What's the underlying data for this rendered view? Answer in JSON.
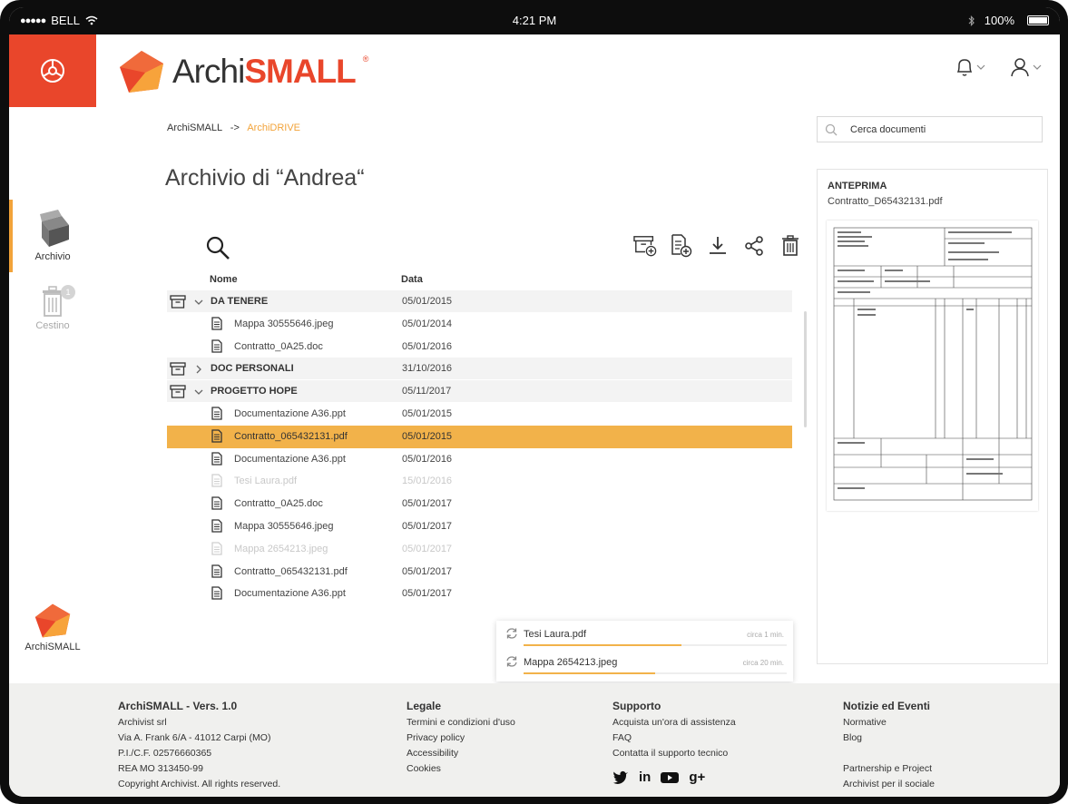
{
  "status_bar": {
    "carrier": "BELL",
    "time": "4:21 PM",
    "battery": "100%",
    "icons": [
      "signal-dots-icon",
      "wifi-icon",
      "bluetooth-icon",
      "battery-icon"
    ]
  },
  "header": {
    "brand_icon": "wheel-icon",
    "logo_prefix": "Archi",
    "logo_bold": "SMALL",
    "logo_reg": "®",
    "notifications_icon": "bell-icon",
    "user_icon": "user-icon",
    "accent_color": "#e9462b"
  },
  "sidebar": {
    "archivio": "Archivio",
    "cestino": "Cestino",
    "cestino_badge": "1",
    "brand": "ArchiSMALL"
  },
  "breadcrumb": {
    "root": "ArchiSMALL",
    "separator": "->",
    "current": "ArchiDRIVE"
  },
  "page": {
    "title": "Archivio di “Andrea“"
  },
  "search": {
    "placeholder": "Cerca documenti"
  },
  "toolbar": {
    "icons": [
      "new-archive-icon",
      "add-document-icon",
      "download-icon",
      "share-icon",
      "trash-icon"
    ]
  },
  "table": {
    "columns": {
      "name": "Nome",
      "date": "Data"
    },
    "rows": [
      {
        "type": "folder",
        "expanded": true,
        "name": "DA TENERE",
        "date": "05/01/2015"
      },
      {
        "type": "file",
        "name": "Mappa 30555646.jpeg",
        "date": "05/01/2014"
      },
      {
        "type": "file",
        "name": "Contratto_0A25.doc",
        "date": "05/01/2016"
      },
      {
        "type": "folder",
        "expanded": false,
        "name": "DOC PERSONALI",
        "date": "31/10/2016"
      },
      {
        "type": "folder",
        "expanded": true,
        "name": "PROGETTO HOPE",
        "date": "05/11/2017"
      },
      {
        "type": "file",
        "name": "Documentazione A36.ppt",
        "date": "05/01/2015"
      },
      {
        "type": "file",
        "name": "Contratto_065432131.pdf",
        "date": "05/01/2015",
        "selected": true
      },
      {
        "type": "file",
        "name": "Documentazione A36.ppt",
        "date": "05/01/2016"
      },
      {
        "type": "file",
        "name": "Tesi Laura.pdf",
        "date": "15/01/2016",
        "dimmed": true
      },
      {
        "type": "file",
        "name": "Contratto_0A25.doc",
        "date": "05/01/2017"
      },
      {
        "type": "file",
        "name": "Mappa 30555646.jpeg",
        "date": "05/01/2017"
      },
      {
        "type": "file",
        "name": "Mappa 2654213.jpeg",
        "date": "05/01/2017",
        "dimmed": true
      },
      {
        "type": "file",
        "name": "Contratto_065432131.pdf",
        "date": "05/01/2017"
      },
      {
        "type": "file",
        "name": "Documentazione A36.ppt",
        "date": "05/01/2017"
      }
    ]
  },
  "uploads": [
    {
      "name": "Tesi Laura.pdf",
      "eta": "circa 1 min.",
      "progress": 0.6
    },
    {
      "name": "Mappa 2654213.jpeg",
      "eta": "circa 20 min.",
      "progress": 0.5
    }
  ],
  "preview": {
    "label": "ANTEPRIMA",
    "filename": "Contratto_D65432131.pdf"
  },
  "footer": {
    "company": {
      "title": "ArchiSMALL - Vers. 1.0",
      "lines": [
        "Archivist srl",
        "Via A. Frank 6/A - 41012 Carpi (MO)",
        "P.I./C.F. 02576660365",
        "REA MO 313450-99",
        "Copyright Archivist. All rights reserved."
      ]
    },
    "legal": {
      "title": "Legale",
      "links": [
        "Termini e condizioni d'uso",
        "Privacy policy",
        "Accessibility",
        "Cookies"
      ]
    },
    "support": {
      "title": "Supporto",
      "links": [
        "Acquista un'ora di assistenza",
        "FAQ",
        "Contatta il supporto tecnico"
      ],
      "social": [
        "twitter-icon",
        "linkedin-icon",
        "youtube-icon",
        "googleplus-icon"
      ],
      "social_labels": {
        "linkedin": "in",
        "googleplus": "g+"
      }
    },
    "news": {
      "title": "Notizie ed Eventi",
      "links": [
        "Normative",
        "Blog"
      ],
      "links2": [
        "Partnership e Project",
        "Archivist per il sociale"
      ]
    }
  },
  "colors": {
    "accent": "#e9462b",
    "highlight": "#f2b24a",
    "breadcrumb_current": "#f2a33a"
  }
}
